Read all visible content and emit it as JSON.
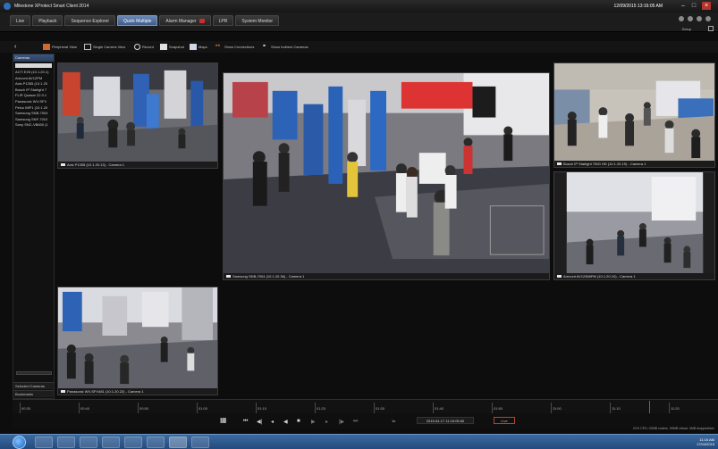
{
  "app": {
    "title": "Milestone XProtect Smart Client 2014",
    "datetime": "12/09/2015 13:16:05 AM"
  },
  "tabs": [
    {
      "label": "Live",
      "active": false
    },
    {
      "label": "Playback",
      "active": false
    },
    {
      "label": "Sequence Explorer",
      "active": false
    },
    {
      "label": "Quick Multiple",
      "active": true
    },
    {
      "label": "Alarm Manager",
      "active": false,
      "badge": true
    },
    {
      "label": "LPR",
      "active": false
    },
    {
      "label": "System Monitor",
      "active": false
    }
  ],
  "setup_label": "Setup",
  "toolbar": {
    "peripheral": "Peripheral View",
    "single_camera": "Single Camera View",
    "record": "Record",
    "snapshot": "Snapshot",
    "maps": "Maps",
    "show_connections": "Show Connections",
    "show_indirect": "Show Indirect Cameras"
  },
  "sidebar": {
    "header": "Cameras",
    "items": [
      "ACTi E25 (10.1.20.1)",
      "Arecont AV12PM",
      "Axis P1355 (10.1.20",
      "Bosch IP Starlight 7",
      "FLIR Quasar 22.0.1",
      "Panasonic WV-SFV",
      "Pelco IMP1 (10.1.20",
      "Samsung SNB-7004",
      "Samsung SNF-7010",
      "Sony SNC-VB600 (1"
    ],
    "section_selected": "Selected Cameras",
    "section_bookmarks": "Bookmarks"
  },
  "views": {
    "v1_caption": "Axis P1355 (10.1.20.13) - Camera 1",
    "v2_caption": "Samsung SNB-7004 (10.1.20.36) - Camera 1",
    "v3_caption": "Bosch IP Starlight 7000 HD (10.1.20.19) - Camera 1",
    "v4_caption": "Arecont AV12366PM (10.1.20.10) - Camera 1",
    "v5_caption": "Panasonic WV-SFV481 (10.1.20.22) - Camera 1"
  },
  "timeline": {
    "labels": [
      "00:30",
      "00:40",
      "00:50",
      "01:00",
      "01:10",
      "01:20",
      "01:30",
      "01:40",
      "01:50",
      "11:00",
      "11:10",
      "11:20"
    ],
    "current_time": "2015-04-17 11:16:05.60",
    "live_label": "Live"
  },
  "status_text": "21% CPU, 02MB coders, 99MB virtual, 0MB dropped/sec",
  "taskbar": {
    "clock_time": "11:16 AM",
    "clock_date": "17/04/2015"
  }
}
